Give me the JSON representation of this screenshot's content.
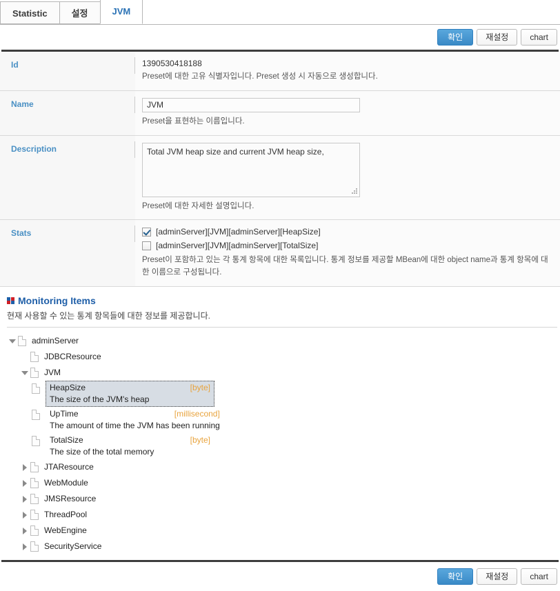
{
  "tabs": [
    {
      "label": "Statistic",
      "active": false
    },
    {
      "label": "설정",
      "active": false
    },
    {
      "label": "JVM",
      "active": true
    }
  ],
  "toolbar": {
    "confirm_label": "확인",
    "reset_label": "재설정",
    "chart_label": "chart"
  },
  "form": {
    "id": {
      "label": "Id",
      "value": "1390530418188",
      "hint": "Preset에 대한 고유 식별자입니다. Preset 생성 시 자동으로 생성합니다."
    },
    "name": {
      "label": "Name",
      "value": "JVM",
      "hint": "Preset을 표현하는 이름입니다."
    },
    "description": {
      "label": "Description",
      "value": "Total JVM heap size and current JVM heap size,",
      "hint": "Preset에 대한 자세한 설명입니다."
    },
    "stats": {
      "label": "Stats",
      "items": [
        {
          "label": "[adminServer][JVM][adminServer][HeapSize]",
          "checked": true
        },
        {
          "label": "[adminServer][JVM][adminServer][TotalSize]",
          "checked": false
        }
      ],
      "hint": "Preset이 포함하고 있는 각 통계 항목에 대한 목록입니다. 통계 정보를 제공할 MBean에 대한 object name과 통계 항목에 대한 이름으로 구성됩니다."
    }
  },
  "monitoring": {
    "title": "Monitoring Items",
    "subtitle": "현재 사용할 수 있는 통계 항목들에 대한 정보를 제공합니다.",
    "root": {
      "label": "adminServer"
    },
    "jdbc": {
      "label": "JDBCResource"
    },
    "jvm": {
      "label": "JVM"
    },
    "stats": [
      {
        "name": "HeapSize",
        "unit": "[byte]",
        "desc": "The size of the JVM's heap",
        "selected": true
      },
      {
        "name": "UpTime",
        "unit": "[millisecond]",
        "desc": "The amount of time the JVM has been running",
        "selected": false
      },
      {
        "name": "TotalSize",
        "unit": "[byte]",
        "desc": "The size of the total memory",
        "selected": false
      }
    ],
    "others": [
      {
        "label": "JTAResource"
      },
      {
        "label": "WebModule"
      },
      {
        "label": "JMSResource"
      },
      {
        "label": "ThreadPool"
      },
      {
        "label": "WebEngine"
      },
      {
        "label": "SecurityService"
      }
    ]
  },
  "footer": {
    "confirm_label": "확인",
    "reset_label": "재설정",
    "chart_label": "chart"
  }
}
